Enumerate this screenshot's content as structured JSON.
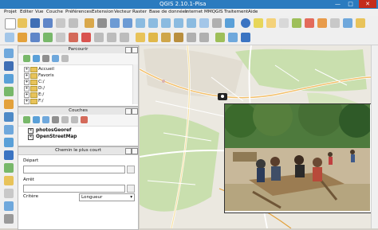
{
  "window": {
    "title": "QGIS 2.10.1-Pisa",
    "minimize": "—",
    "maximize": "□",
    "close": "✕"
  },
  "menu": [
    "Projet",
    "Editer",
    "Vue",
    "Couche",
    "Préférences",
    "Extension",
    "Vecteur",
    "Raster",
    "Base de données",
    "Internet",
    "MMQGIS",
    "Traitement",
    "Aide"
  ],
  "panels": {
    "browser": {
      "title": "Parcourir",
      "items": [
        {
          "label": "Accueil",
          "kind": "folder"
        },
        {
          "label": "Favoris",
          "kind": "folder"
        },
        {
          "label": "C:/",
          "kind": "drive"
        },
        {
          "label": "D:/",
          "kind": "drive"
        },
        {
          "label": "E:/",
          "kind": "drive"
        },
        {
          "label": "F:/",
          "kind": "drive"
        },
        {
          "label": "G:/",
          "kind": "drive"
        }
      ]
    },
    "layers": {
      "title": "Couches",
      "items": [
        {
          "label": "photosGeoref",
          "checked": true
        },
        {
          "label": "OpenStreetMap",
          "checked": true
        }
      ]
    },
    "route": {
      "title": "Chemin le plus court",
      "start_label": "Départ",
      "end_label": "Arrêt",
      "criterion_label": "Critère",
      "criterion_value": "Longueur"
    }
  },
  "photo": {
    "camera_icon": "camera-icon"
  },
  "colors": {
    "titlebar": "#2b7bbf",
    "map_green": "#c9dfae",
    "map_base": "#ebe8e0"
  }
}
